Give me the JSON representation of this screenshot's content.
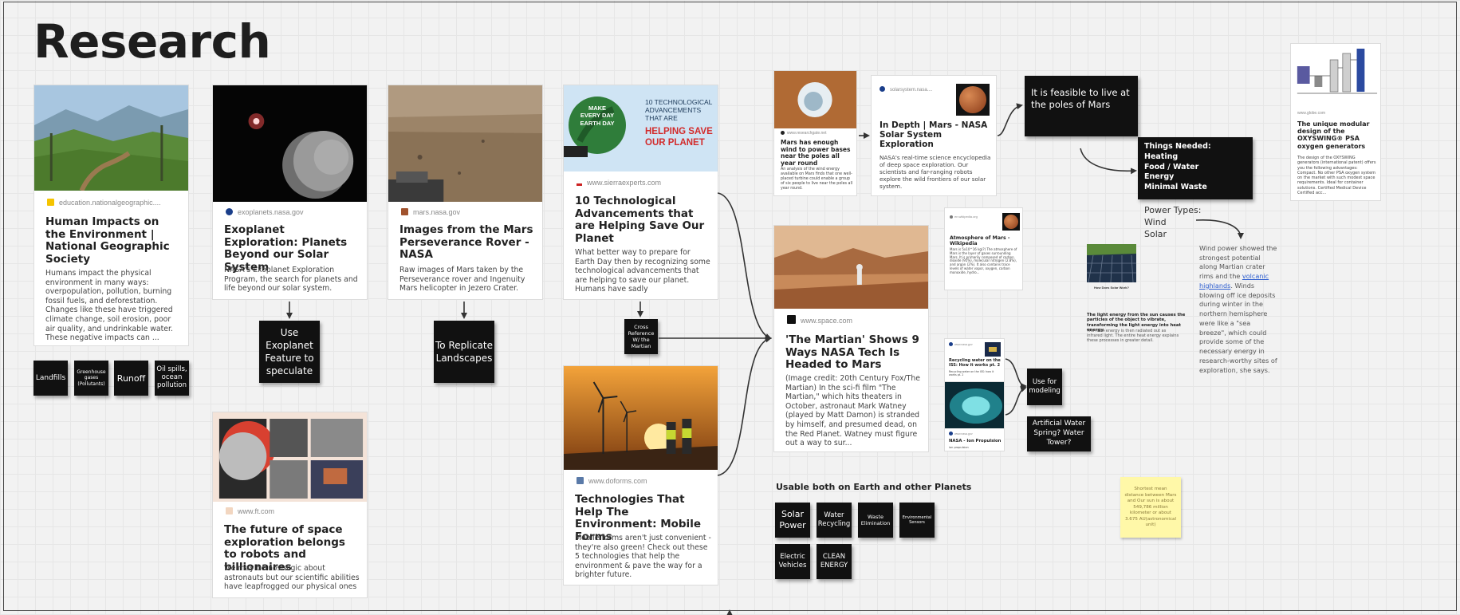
{
  "board": {
    "title": "Research"
  },
  "cards": {
    "natgeo": {
      "source": "education.nationalgeographic....",
      "title": "Human Impacts on the Environment | National Geographic Society",
      "desc": "Humans impact the physical environment in many ways: overpopulation, pollution, burning fossil fuels, and deforestation. Changes like these have triggered climate change, soil erosion, poor air quality, and undrinkable water. These negative impacts can ..."
    },
    "exoplanet": {
      "source": "exoplanets.nasa.gov",
      "title": "Exoplanet Exploration: Planets Beyond our Solar System",
      "desc": "NASA's Exoplanet Exploration Program, the search for planets and life beyond our solar system."
    },
    "perseverance": {
      "source": "mars.nasa.gov",
      "title": "Images from the Mars Perseverance Rover - NASA",
      "desc": "Raw images of Mars taken by the Perseverance rover and Ingenuity Mars helicopter in Jezero Crater."
    },
    "sierra": {
      "source": "www.sierraexperts.com",
      "title": "10 Technological Advancements that are Helping Save Our Planet",
      "desc": "What better way to prepare for Earth Day then by recognizing some technological advancements that are helping to save our planet. Humans have sadly",
      "banner_left": "MAKE EVERY DAY EARTH DAY",
      "banner_top": "10 TECHNOLOGICAL ADVANCEMENTS THAT ARE",
      "banner_red": "HELPING SAVE OUR PLANET"
    },
    "doforms": {
      "source": "www.doforms.com",
      "title": "Technologies That Help The Environment: Mobile Forms",
      "desc": "Mobile forms aren't just convenient - they're also green! Check out these 5 technologies that help the environment & pave the way for a brighter future."
    },
    "ft": {
      "source": "www.ft.com",
      "title": "The future of space exploration belongs to robots and billionaires",
      "desc": "We may be nostalgic about astronauts but our scientific abilities have leapfrogged our physical ones"
    },
    "marswind": {
      "source": "www.researchgate.net",
      "title": "Mars has enough wind to power bases near the poles all year round",
      "desc": "An analysis of the wind energy available on Mars finds that one well-placed turbine could enable a group of six people to live near the poles all year round."
    },
    "indepth": {
      "source": "solarsystem.nasa....",
      "title": "In Depth | Mars - NASA Solar System Exploration",
      "desc": "NASA's real-time science encyclopedia of deep space exploration. Our scientists and far-ranging robots explore the wild frontiers of our solar system."
    },
    "martian": {
      "source": "www.space.com",
      "title": "'The Martian' Shows 9 Ways NASA Tech Is Headed to Mars",
      "desc": "(Image credit: 20th Century Fox/The Martian) In the sci-fi film \"The Martian,\" which hits theaters in October, astronaut Mark Watney (played by Matt Damon) is stranded by himself, and presumed dead, on the Red Planet. Watney must figure out a way to sur..."
    },
    "atmosphere": {
      "source": "en.wikipedia.org",
      "title": "Atmosphere of Mars - Wikipedia",
      "desc": "Mars is 5x10^16 kg(?) The atmosphere of Mars is the layer of gases surrounding Mars. It is primarily composed of carbon dioxide (95%), molecular nitrogen (2.8%), and argon (2%). It also contains trace levels of water vapor, oxygen, carbon monoxide, hydro..."
    },
    "water": {
      "source": "www.nasa.gov",
      "title": "Recycling water on the ISS: How it works pt. 2",
      "desc": "Recycling water on the ISS: how it works pt. 2"
    },
    "ion": {
      "source": "www.nasa.gov",
      "title": "NASA - Ion Propulsion",
      "desc": "ion propulsion"
    },
    "solar": {
      "title": "How Does Solar Work?",
      "caption_bold": "The light energy from the sun causes the particles of the object to vibrate, transforming the light energy into heat energy.",
      "caption": "The heat energy is then radiated out as infrared light. The entire heat energy explains these processes in greater detail."
    },
    "oxygen": {
      "source": "www.globe.com",
      "title": "The unique modular design of the OXYSWING® PSA oxygen generators",
      "desc": "The design of the OXYSWING generators (international patent) offers you the following advantages: Compact. No other PSA oxygen system on the market with such modest space requirements. Ideal for container solutions. Certified Medical Device Certified acc..."
    }
  },
  "stickies": {
    "landfills": "Landfills",
    "greenhouse": "Greenhouse gases (Pollutants)",
    "runoff": "Runoff",
    "oil": "Oil spills, ocean pollution",
    "exoplanet_feature": "Use Exoplanet Feature to speculate",
    "replicate": "To Replicate Landscapes",
    "cross_ref": "Cross Reference W/ the Martian",
    "feasible": "It is feasible to live at the poles of Mars",
    "things_needed": [
      "Things Needed:",
      "Heating",
      "Food / Water",
      "Energy",
      "Minimal Waste"
    ],
    "modeling": "Use for modeling",
    "artificial": "Artificial Water Spring? Water Tower?",
    "solar_power": "Solar Power",
    "water_recycling": "Water Recycling",
    "waste_elim": "Waste Elimination",
    "env_sensors": "Environmental Sensors",
    "electric": "Electric Vehicles",
    "clean": "CLEAN ENERGY"
  },
  "notes": {
    "usable": "Usable both on Earth and other Planets",
    "power_types": [
      "Power Types:",
      "Wind",
      "Solar"
    ],
    "wind_text_1": "Wind power showed the strongest potential along Martian crater rims and the ",
    "wind_link": "volcanic highlands",
    "wind_text_2": ". Winds blowing off ice deposits during winter in the northern hemisphere were like a \"sea breeze\", which could provide some of the necessary energy in research-worthy sites of exploration, she says.",
    "yellow": "Shortest mean distance between Mars and Our sun is about 549,786 million kilometer or about 3.675 AU(astronomical unit)"
  },
  "colors": {
    "sticky": "#111111",
    "yellow_note": "#fff8a8",
    "link": "#2b5ccf",
    "banner_red": "#d22b2b"
  }
}
